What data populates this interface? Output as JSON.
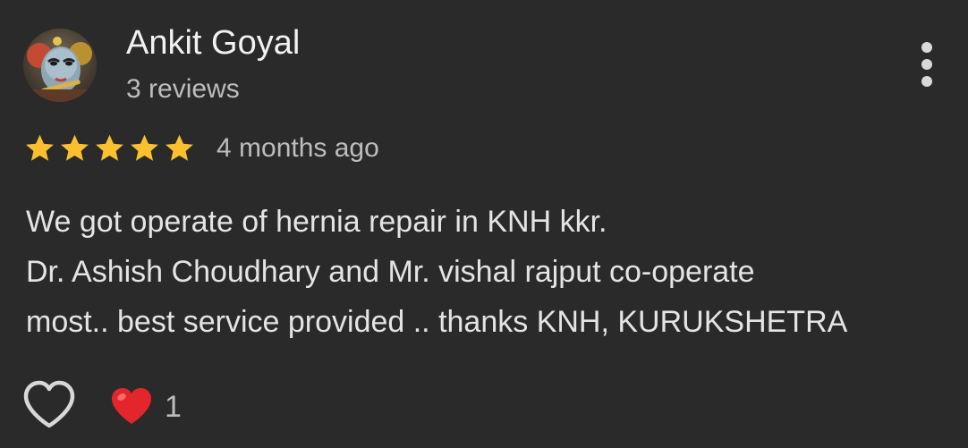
{
  "review": {
    "reviewer_name": "Ankit Goyal",
    "review_count": "3 reviews",
    "rating": 5,
    "rating_max": 5,
    "time": "4 months ago",
    "text_lines": [
      "We got operate of hernia repair in KNH kkr.",
      "Dr. Ashish Choudhary and Mr. vishal rajput co-operate",
      "most.. best service provided .. thanks KNH, KURUKSHETRA"
    ],
    "reactions": {
      "emoji": "heart",
      "count": "1"
    }
  },
  "icons": {
    "more": "more-vertical-icon",
    "like": "heart-outline-icon",
    "reaction": "red-heart-icon",
    "star": "star-icon"
  },
  "colors": {
    "background": "#2a2a2a",
    "star": "#fbc02d",
    "heart": "#e53935",
    "text_primary": "#f1f1f1",
    "text_secondary": "#bdbdbd"
  }
}
